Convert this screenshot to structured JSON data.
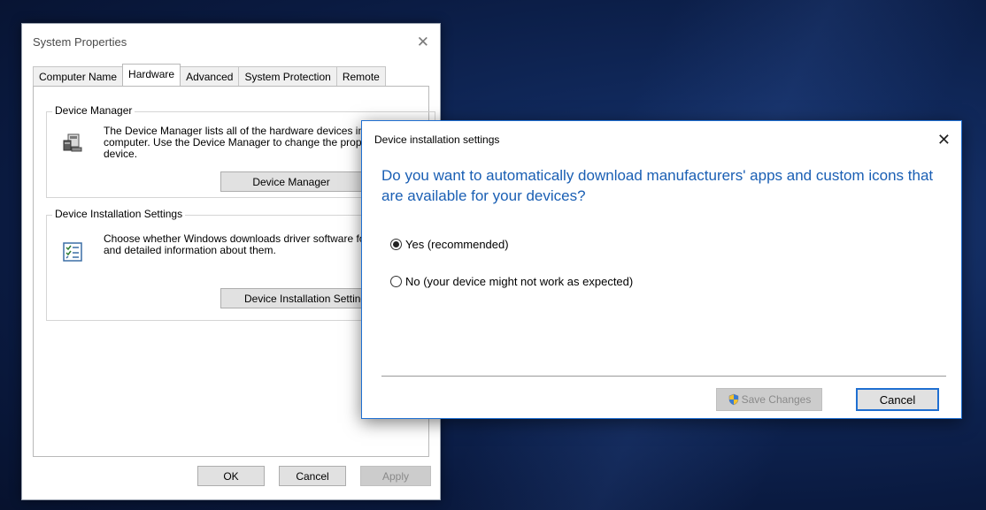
{
  "system_properties": {
    "title": "System Properties",
    "close_glyph": "✕",
    "tabs": [
      {
        "label": "Computer Name",
        "active": false
      },
      {
        "label": "Hardware",
        "active": true
      },
      {
        "label": "Advanced",
        "active": false
      },
      {
        "label": "System Protection",
        "active": false
      },
      {
        "label": "Remote",
        "active": false
      }
    ],
    "device_manager": {
      "heading": "Device Manager",
      "description": "The Device Manager lists all of the hardware devices installed on your computer. Use the Device Manager to change the properties of any device.",
      "button_label": "Device Manager",
      "icon": "device-manager-icon"
    },
    "device_installation": {
      "heading": "Device Installation Settings",
      "description": "Choose whether Windows downloads driver software for your devices and detailed information about them.",
      "button_label": "Device Installation Settings",
      "icon": "checklist-icon"
    },
    "buttons": {
      "ok": "OK",
      "cancel": "Cancel",
      "apply": "Apply"
    }
  },
  "device_installation_dialog": {
    "title": "Device installation settings",
    "close_glyph": "✕",
    "question": "Do you want to automatically download manufacturers' apps and custom icons that are available for your devices?",
    "options": [
      {
        "label": "Yes (recommended)",
        "selected": true
      },
      {
        "label": "No (your device might not work as expected)",
        "selected": false
      }
    ],
    "save_label": "Save Changes",
    "save_icon": "uac-shield-icon",
    "cancel_label": "Cancel"
  },
  "colors": {
    "accent_blue": "#1a5fb4",
    "focus_border": "#1f6fd1",
    "desktop_blue": "#10285a"
  }
}
